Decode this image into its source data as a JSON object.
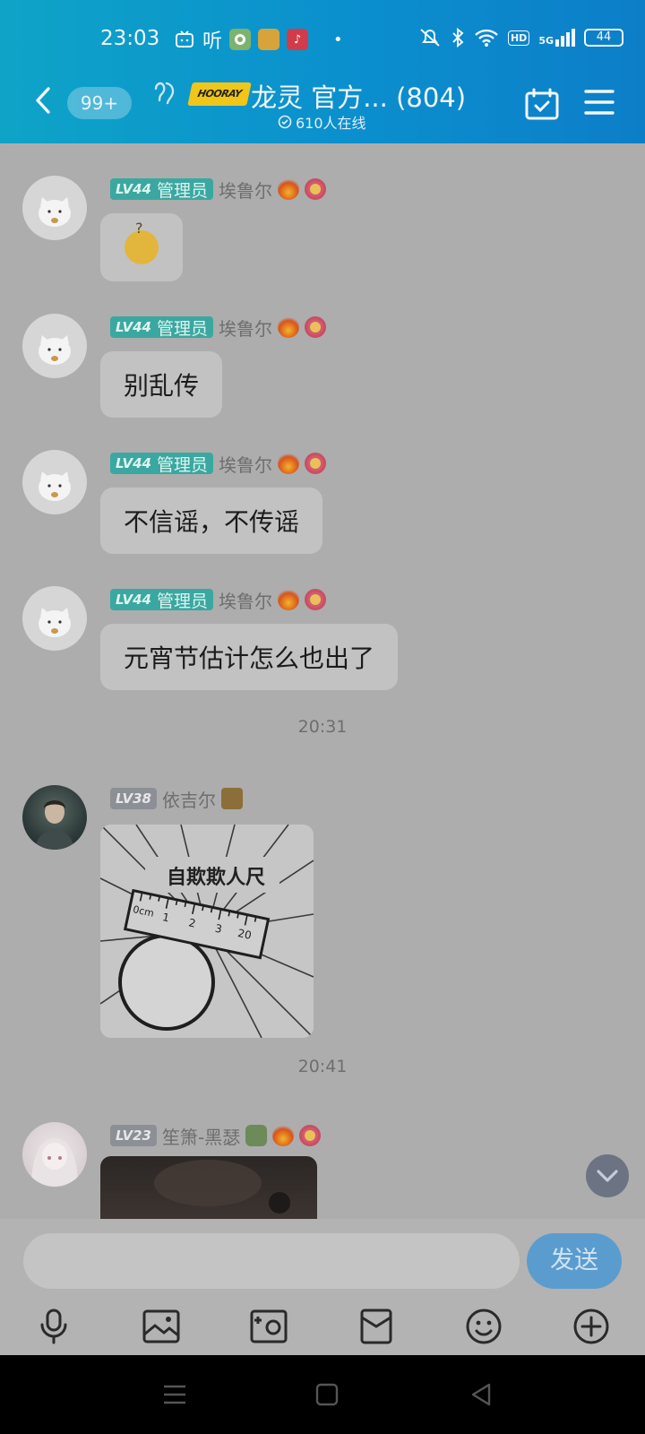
{
  "status_bar": {
    "time": "23:03",
    "app_icons": [
      "bilibili-icon",
      "ting-icon",
      "green-app-icon",
      "game-app-icon",
      "douyin-icon"
    ],
    "more_dot": "•",
    "ting_label": "听",
    "hd_label": "HD",
    "network_label": "5G",
    "battery_level": "44"
  },
  "header": {
    "unread_badge": "99+",
    "group_logo_text": "HOORAY",
    "group_title": "龙灵 官方... (804)",
    "online_count": "610人在线"
  },
  "messages": [
    {
      "level": "LV44",
      "role": "管理员",
      "sender": "埃鲁尔",
      "type": "sticker"
    },
    {
      "level": "LV44",
      "role": "管理员",
      "sender": "埃鲁尔",
      "text": "别乱传"
    },
    {
      "level": "LV44",
      "role": "管理员",
      "sender": "埃鲁尔",
      "text": "不信谣，不传谣"
    },
    {
      "level": "LV44",
      "role": "管理员",
      "sender": "埃鲁尔",
      "text": "元宵节估计怎么也出了"
    },
    {
      "time": "20:31"
    },
    {
      "level": "LV38",
      "sender": "依吉尔",
      "type": "image",
      "image_text": "自欺欺人尺",
      "ruler_marks": [
        "0cm",
        "1",
        "2",
        "3",
        "20"
      ]
    },
    {
      "time": "20:41"
    },
    {
      "level": "LV23",
      "sender": "笙箫-黑瑟",
      "type": "image"
    }
  ],
  "input": {
    "placeholder": "",
    "send_label": "发送"
  },
  "toolbar": [
    "mic-icon",
    "photo-icon",
    "camera-icon",
    "red-packet-icon",
    "emoji-icon",
    "plus-icon"
  ]
}
